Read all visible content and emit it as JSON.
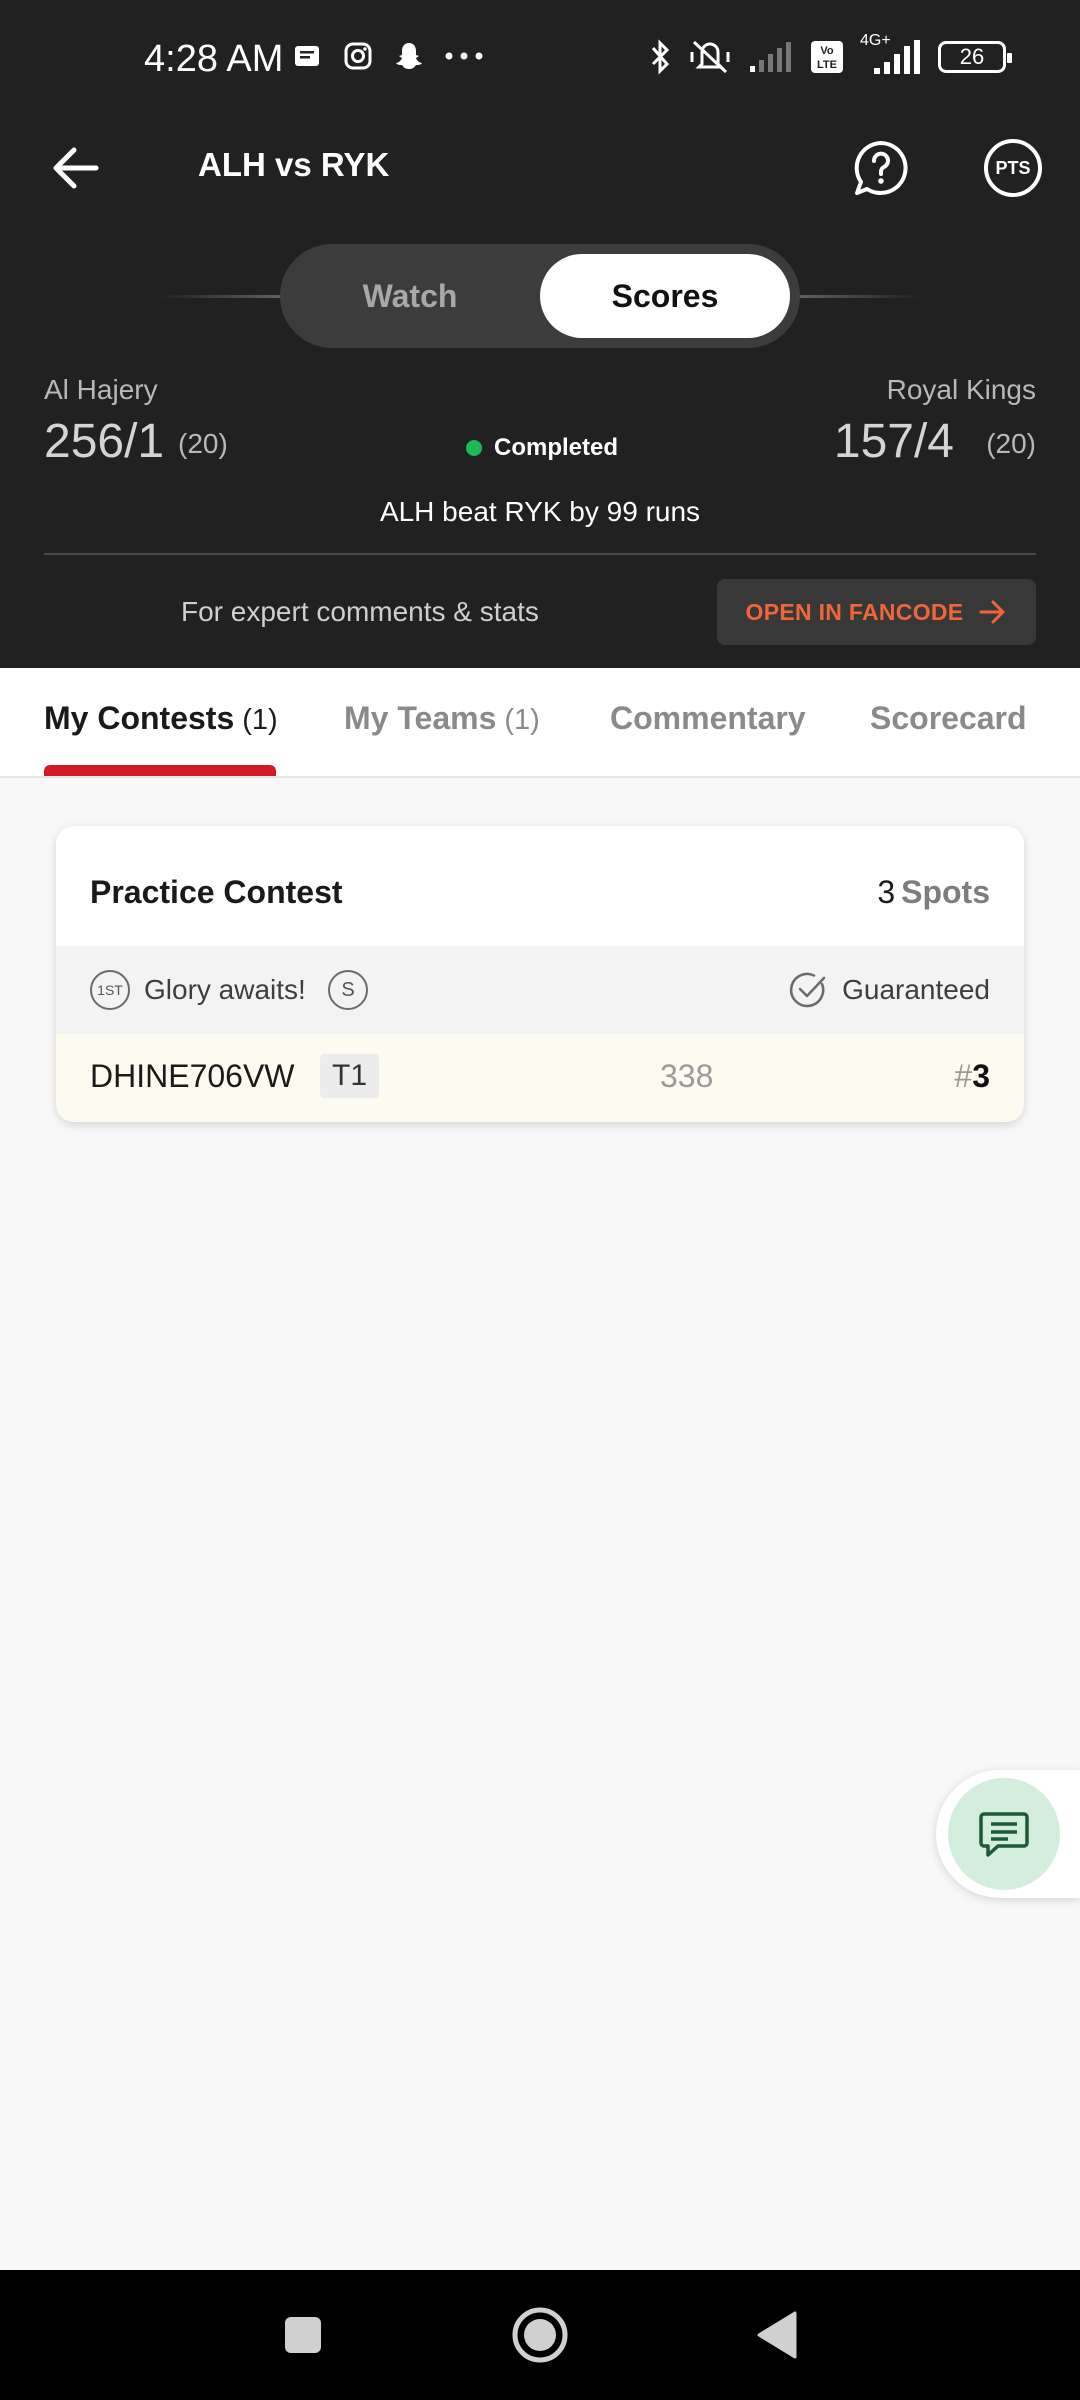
{
  "status_bar": {
    "time": "4:28 AM",
    "network": "4G+",
    "volte": "Vo LTE",
    "battery": "26"
  },
  "topbar": {
    "title": "ALH vs RYK",
    "pts_label": "PTS"
  },
  "toggle": {
    "watch": "Watch",
    "scores": "Scores",
    "selected": "Scores"
  },
  "match": {
    "team1": {
      "name": "Al Hajery",
      "score": "256/1",
      "overs": "(20)"
    },
    "team2": {
      "name": "Royal Kings",
      "score": "157/4",
      "overs": "(20)"
    },
    "status": "Completed",
    "status_color": "#1db954",
    "result": "ALH beat RYK by 99 runs"
  },
  "promo": {
    "text": "For expert comments & stats",
    "button": "OPEN IN FANCODE",
    "button_color": "#f0663a"
  },
  "tabs": [
    {
      "label": "My Contests",
      "count": "(1)",
      "active": true
    },
    {
      "label": "My Teams",
      "count": "(1)",
      "active": false
    },
    {
      "label": "Commentary",
      "count": "",
      "active": false
    },
    {
      "label": "Scorecard",
      "count": "",
      "active": false
    }
  ],
  "accent_color": "#d11a24",
  "contest": {
    "name": "Practice Contest",
    "spots_count": "3",
    "spots_label": "Spots",
    "first_badge": "1ST",
    "glory_text": "Glory awaits!",
    "single_badge": "S",
    "guaranteed": "Guaranteed",
    "entry": {
      "username": "DHINE706VW",
      "team": "T1",
      "points": "338",
      "rank_prefix": "#",
      "rank": "3"
    }
  },
  "icons": {
    "back": "arrow-left-icon",
    "help": "question-bubble-icon",
    "pts": "points-icon",
    "chat": "chat-icon",
    "fancode_arrow": "arrow-right-icon"
  }
}
